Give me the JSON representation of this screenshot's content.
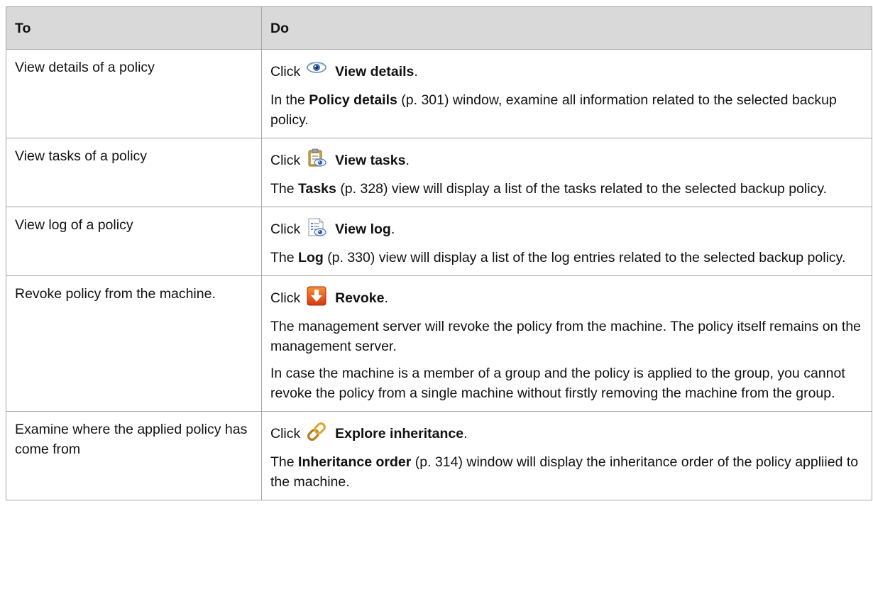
{
  "table": {
    "headers": {
      "to": "To",
      "do": "Do"
    },
    "rows": [
      {
        "task": "View details of a policy",
        "click_prefix": "Click",
        "action": "View details",
        "icon": "eye-icon",
        "desc1": {
          "pre": "In the",
          "term": "Policy details",
          "post": "(p. 301) window, examine all information related to the selected backup policy."
        }
      },
      {
        "task": "View tasks of a policy",
        "click_prefix": "Click",
        "action": "View tasks",
        "icon": "view-tasks-icon",
        "desc1": {
          "pre": "The",
          "term": "Tasks",
          "post": "(p. 328) view will display a list of the tasks related to the selected backup policy."
        }
      },
      {
        "task": "View log of a policy",
        "click_prefix": "Click",
        "action": "View log",
        "icon": "view-log-icon",
        "desc1": {
          "pre": "The",
          "term": "Log",
          "post": "(p. 330) view will display a list of the log entries related to the selected backup policy."
        }
      },
      {
        "task": "Revoke policy from the machine.",
        "click_prefix": "Click",
        "action": "Revoke",
        "icon": "revoke-arrow-icon",
        "desc1": "The management server will revoke the policy from the machine. The policy itself remains on the management server.",
        "desc2": "In case the machine is a member of a group and the policy is applied to the group, you cannot revoke the policy from a single machine without firstly removing the machine from the group."
      },
      {
        "task": "Examine where the applied policy has come from",
        "click_prefix": "Click",
        "action": "Explore inheritance",
        "icon": "chain-link-icon",
        "desc1": {
          "pre": "The",
          "term": "Inheritance order",
          "post": "(p. 314) window will display the inheritance order of the policy appliied to the machine."
        }
      }
    ]
  },
  "colors": {
    "header_bg": "#d9d9d9",
    "border": "#a6a6a6",
    "revoke_icon": "#e8501a"
  }
}
